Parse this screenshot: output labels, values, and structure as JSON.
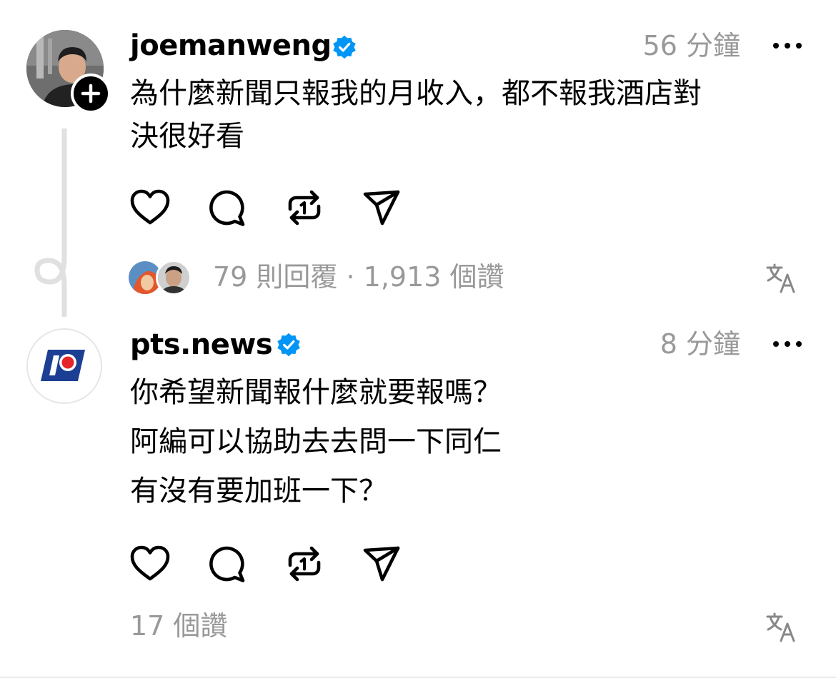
{
  "post": {
    "username": "joemanweng",
    "verified": true,
    "time": "56 分鐘",
    "text_line1": "為什麼新聞只報我的月收入，都不報我酒店對",
    "text_line2": "決很好看",
    "stats": "79 則回覆 · 1,913 個讚",
    "icons": [
      "heart-icon",
      "comment-icon",
      "repost-icon",
      "share-icon",
      "more-icon",
      "translate-icon",
      "follow-plus-icon",
      "verified-badge-icon"
    ]
  },
  "reply": {
    "username": "pts.news",
    "verified": true,
    "time": "8 分鐘",
    "text_line1": "你希望新聞報什麼就要報嗎？",
    "text_line2": "阿編可以協助去去問一下同仁",
    "text_line3": "有沒有要加班一下？",
    "stats": "17 個讚"
  },
  "colors": {
    "verified_blue": "#0095f6",
    "muted_gray": "#999999",
    "thread_line": "#e0e0e0",
    "pts_blue": "#1c3f94",
    "pts_red": "#e5252a"
  }
}
